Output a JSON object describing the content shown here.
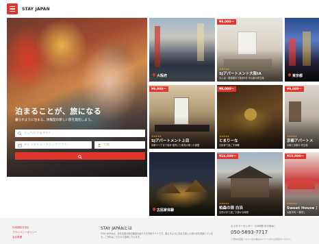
{
  "header": {
    "brand": "STAY JAPAN"
  },
  "hero": {
    "title": "泊まることが、旅になる",
    "subtitle": "暮らすように泊まる。体験型の新しい旅を発見しよう。",
    "place_placeholder": "どこへ行きますか？",
    "date_placeholder": "チェックイン・チェックアウト",
    "guests_placeholder": "人数"
  },
  "listings": [
    {
      "kind": "city",
      "city": "大阪府"
    },
    {
      "kind": "stay",
      "price": "¥9,000～",
      "stars": "★★★★★",
      "name": "SJアパートメント大阪IA",
      "desc": "なんば・道頓堀まで徒歩5分 中心部の好立地"
    },
    {
      "kind": "city",
      "city": "東京都"
    },
    {
      "kind": "stay",
      "price": "¥9,000～",
      "stars": "★★★★★",
      "name": "SJアパートメント上目",
      "desc": "京都エリアまで徒歩 室内にも家具の揃った部屋"
    },
    {
      "kind": "stay",
      "price": "¥9,000～",
      "stars": "★★★★★",
      "name": "とまりーな",
      "desc": "古民家で過ごす体験"
    },
    {
      "kind": "stay",
      "price": "¥9,000～",
      "stars": "★★★★★",
      "name": "京都アパートメ",
      "desc": "大阪と京都の 好立地"
    },
    {
      "kind": "city",
      "city": "古民家体験"
    },
    {
      "kind": "stay",
      "price": "¥14,000～",
      "stars": "★★★★★",
      "name": "柏森の宿 白浜",
      "desc": "自然の中で過ごす静かな時間"
    },
    {
      "kind": "stay",
      "price": "¥15,000～",
      "stars": "★★★★★",
      "name": "Sweet House 丸",
      "desc": "大阪市内 一棟貸し"
    }
  ],
  "footer": {
    "links": [
      "利用規約を読む",
      "プライバシーポリシー",
      "会社概要"
    ],
    "about_title": "STAY JAPANとは",
    "about_text": "STAY JAPANは、日本全国の宿泊施設を紹介する予約サイトです。暮らすように泊まる新しい旅の形を提案しています。ご予約はこちらから簡単に行えます。",
    "support_label": "カスタマーセンター（24時間 年中無休）",
    "phone": "050-5893-7717",
    "support_note": "ご予約の変更・キャンセル等はマイページからお手続きください。"
  },
  "colors": {
    "accent": "#e0362e"
  }
}
